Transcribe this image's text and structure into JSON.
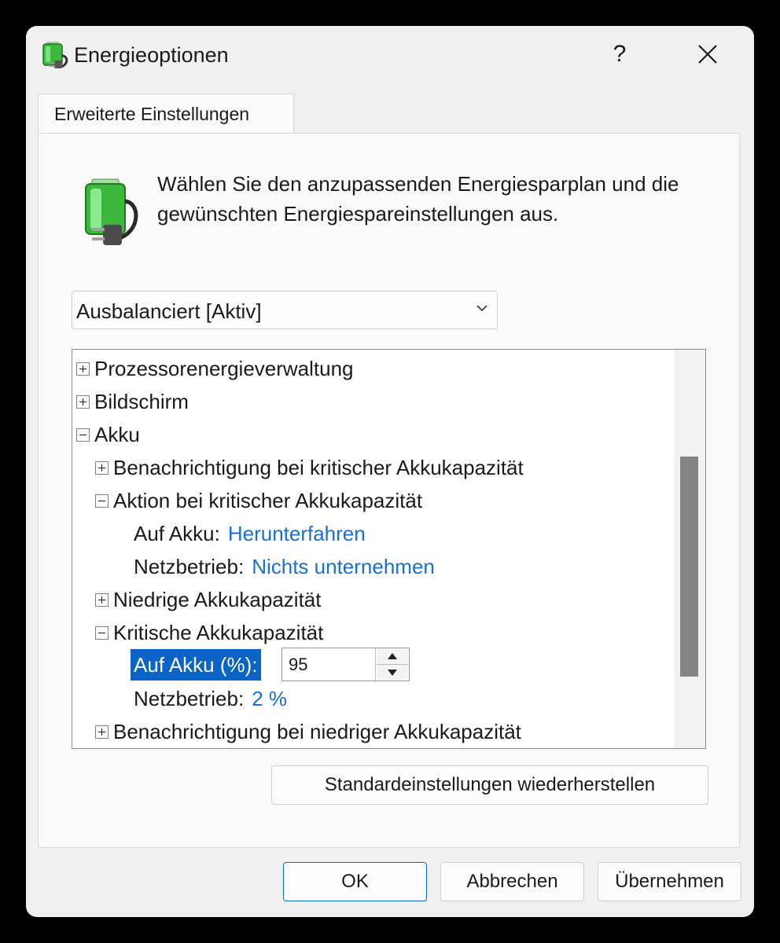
{
  "window": {
    "title": "Energieoptionen",
    "help_label": "?",
    "close_label": "✕"
  },
  "tab": {
    "label": "Erweiterte Einstellungen"
  },
  "description": "Wählen Sie den anzupassenden Energiesparplan und die gewünschten Energiespareinstellungen aus.",
  "plan_select": {
    "value": "Ausbalanciert [Aktiv]"
  },
  "tree": {
    "items": [
      {
        "label": "Prozessorenergieverwaltung",
        "state": "collapsed"
      },
      {
        "label": "Bildschirm",
        "state": "collapsed"
      },
      {
        "label": "Akku",
        "state": "expanded"
      },
      {
        "label": "Benachrichtigung bei kritischer Akkukapazität",
        "state": "collapsed"
      },
      {
        "label": "Aktion bei kritischer Akkukapazität",
        "state": "expanded"
      },
      {
        "label": "Auf Akku:",
        "value": "Herunterfahren"
      },
      {
        "label": "Netzbetrieb:",
        "value": "Nichts unternehmen"
      },
      {
        "label": "Niedrige Akkukapazität",
        "state": "collapsed"
      },
      {
        "label": "Kritische Akkukapazität",
        "state": "expanded"
      },
      {
        "label": "Auf Akku (%):",
        "value": "95",
        "selected": true
      },
      {
        "label": "Netzbetrieb:",
        "value": "2 %"
      },
      {
        "label": "Benachrichtigung bei niedriger Akkukapazität",
        "state": "collapsed"
      }
    ]
  },
  "buttons": {
    "restore": "Standardeinstellungen wiederherstellen",
    "ok": "OK",
    "cancel": "Abbrechen",
    "apply": "Übernehmen"
  },
  "colors": {
    "link": "#1a6fd0",
    "selection": "#0a64c8",
    "battery_green": "#3cb83c"
  }
}
